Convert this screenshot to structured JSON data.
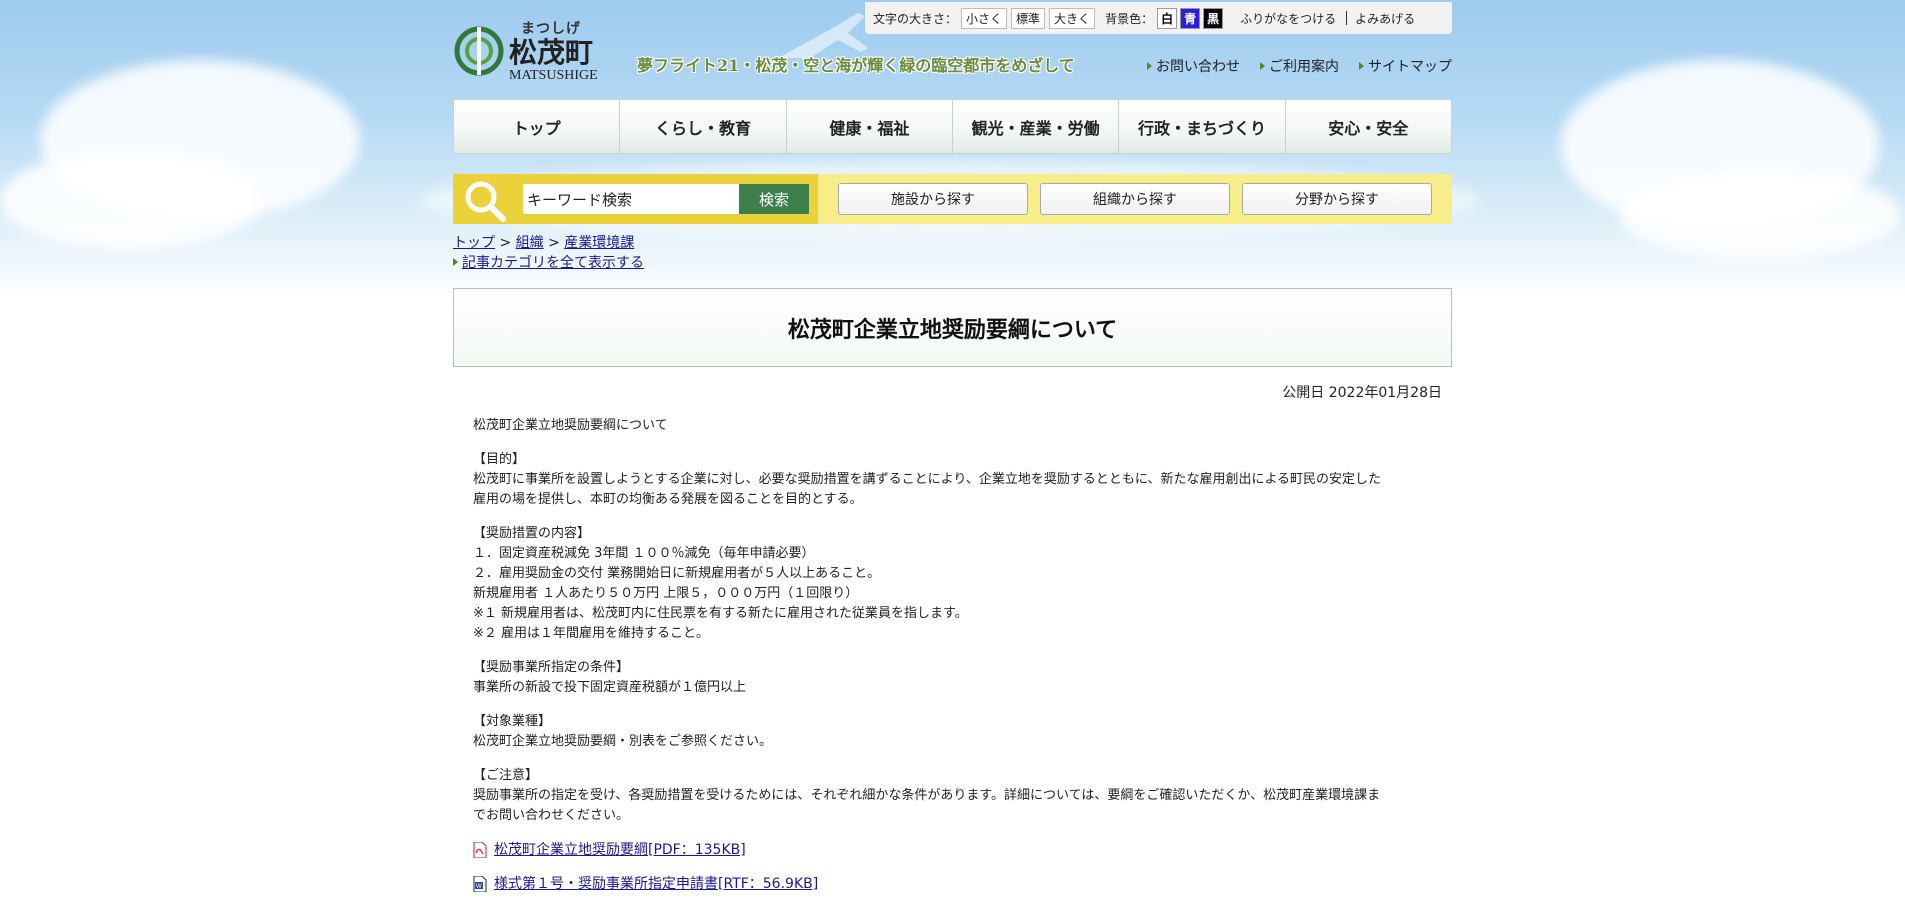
{
  "utility": {
    "text_size_label": "文字の大きさ：",
    "size_small": "小さく",
    "size_normal": "標準",
    "size_large": "大きく",
    "bg_label": "背景色：",
    "bg_white": "白",
    "bg_blue": "青",
    "bg_black": "黒",
    "furigana": "ふりがなをつける",
    "readaloud": "よみあげる"
  },
  "logo": {
    "kana": "まつしげ",
    "kanji": "松茂町",
    "roman": "MATSUSHIGE"
  },
  "slogan": "夢フライト21・松茂・空と海が輝く緑の臨空都市をめざして",
  "sublinks": {
    "contact": "お問い合わせ",
    "guide": "ご利用案内",
    "sitemap": "サイトマップ"
  },
  "nav": [
    "トップ",
    "くらし・教育",
    "健康・福祉",
    "観光・産業・労働",
    "行政・まちづくり",
    "安心・安全"
  ],
  "search": {
    "placeholder": "キーワード検索",
    "button": "検索",
    "find_facility": "施設から探す",
    "find_org": "組織から探す",
    "find_field": "分野から探す"
  },
  "breadcrumb": {
    "top": "トップ",
    "sep": " > ",
    "org": "組織",
    "dept": "産業環境課",
    "all_categories": "記事カテゴリを全て表示する"
  },
  "page": {
    "title": "松茂町企業立地奨励要綱について",
    "published": "公開日 2022年01月28日"
  },
  "body": {
    "intro": "松茂町企業立地奨励要綱について",
    "purpose_h": "【目的】",
    "purpose_1": "松茂町に事業所を設置しようとする企業に対し、必要な奨励措置を講ずることにより、企業立地を奨励するとともに、新たな雇用創出による町民の安定した",
    "purpose_2": "雇用の場を提供し、本町の均衡ある発展を図ることを目的とする。",
    "measures_h": "【奨励措置の内容】",
    "measures_1": "１．固定資産税減免 3年間 １００％減免（毎年申請必要）",
    "measures_2": "２．雇用奨励金の交付 業務開始日に新規雇用者が５人以上あること。",
    "measures_3": "新規雇用者 １人あたり５０万円 上限５，０００万円（１回限り）",
    "measures_4": "※１ 新規雇用者は、松茂町内に住民票を有する新たに雇用された従業員を指します。",
    "measures_5": "※２ 雇用は１年間雇用を維持すること。",
    "conditions_h": "【奨励事業所指定の条件】",
    "conditions_1": "事業所の新設で投下固定資産税額が１億円以上",
    "industry_h": "【対象業種】",
    "industry_1": "松茂町企業立地奨励要綱・別表をご参照ください。",
    "notice_h": "【ご注意】",
    "notice_1": "奨励事業所の指定を受け、各奨励措置を受けるためには、それぞれ細かな条件があります。詳細については、要綱をご確認いただくか、松茂町産業環境課ま",
    "notice_2": "でお問い合わせください。",
    "file_1": "松茂町企業立地奨励要綱[PDF：135KB]",
    "file_2": "様式第１号・奨励事業所指定申請書[RTF：56.9KB]"
  },
  "colors": {
    "nav_border": "#c8d2cc",
    "search_dark": "#ecd23a",
    "search_light": "#f7ee8a",
    "search_button": "#3f7e4d",
    "link": "#1a1a8c",
    "title_border": "#a8c8b0"
  }
}
